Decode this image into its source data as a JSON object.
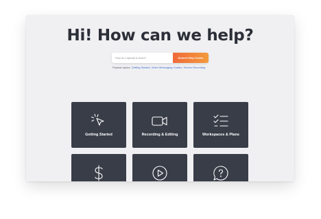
{
  "hero": {
    "title": "Hi! How can we help?"
  },
  "search": {
    "placeholder": "How do I upload a video?",
    "button_label": "Search Help Center"
  },
  "popular": {
    "prefix": "Popular topics:",
    "topics": [
      "Getting Started",
      "Video Messaging Guides",
      "Screen Recording"
    ],
    "separator": ", "
  },
  "cards": [
    {
      "label": "Getting Started",
      "icon": "cursor-click-icon"
    },
    {
      "label": "Recording & Editing",
      "icon": "video-camera-icon"
    },
    {
      "label": "Workspaces & Plans",
      "icon": "checklist-icon"
    },
    {
      "label": "",
      "icon": "dollar-icon"
    },
    {
      "label": "",
      "icon": "play-circle-icon"
    },
    {
      "label": "",
      "icon": "question-bubble-icon"
    }
  ],
  "colors": {
    "background": "#f0f0f2",
    "card": "#383d48",
    "accent_start": "#f06a3a",
    "accent_end": "#f39a3b",
    "link": "#3a6fd0"
  }
}
